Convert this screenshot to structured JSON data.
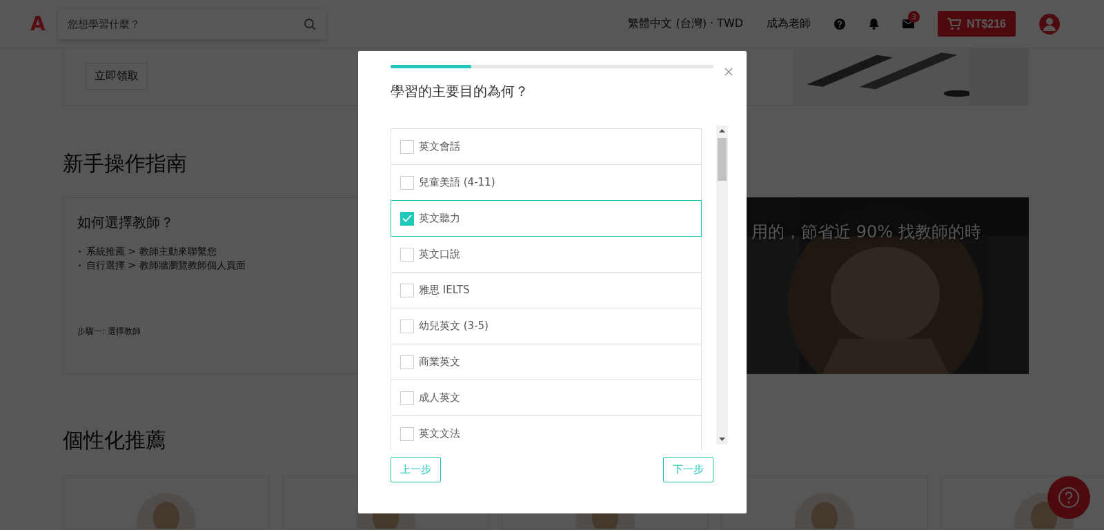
{
  "header": {
    "logo": "A",
    "search_placeholder": "您想學習什麼？",
    "language": "繁體中文 (台灣) · TWD",
    "become_teacher": "成為老師",
    "mail_badge": "3",
    "cart_total": "NT$216"
  },
  "promo": {
    "button": "立即領取"
  },
  "guide": {
    "heading": "新手操作指南",
    "card_title": "如何選擇教師？",
    "bullets": [
      "系統推薦 > 教師主動來聯繫您",
      "自行選擇 > 教師牆瀏覽教師個人頁面"
    ],
    "step": "步驟一: 選擇教師",
    "banner_text": "用的，節省近 90% 找教師的時"
  },
  "recommend": {
    "heading": "個性化推薦"
  },
  "modal": {
    "progress": {
      "level": 0.25
    },
    "title": "學習的主要目的為何？",
    "options": [
      {
        "label": "英文會話",
        "checked": false,
        "selected": false
      },
      {
        "label": "兒童美語 (4-11)",
        "checked": false,
        "selected": false
      },
      {
        "label": "英文聽力",
        "checked": true,
        "selected": true
      },
      {
        "label": "英文口說",
        "checked": false,
        "selected": false
      },
      {
        "label": "雅思 IELTS",
        "checked": false,
        "selected": false
      },
      {
        "label": "幼兒英文 (3-5)",
        "checked": false,
        "selected": false
      },
      {
        "label": "商業英文",
        "checked": false,
        "selected": false
      },
      {
        "label": "成人英文",
        "checked": false,
        "selected": false
      },
      {
        "label": "英文文法",
        "checked": false,
        "selected": false
      }
    ],
    "back": "上一步",
    "next": "下一步"
  }
}
